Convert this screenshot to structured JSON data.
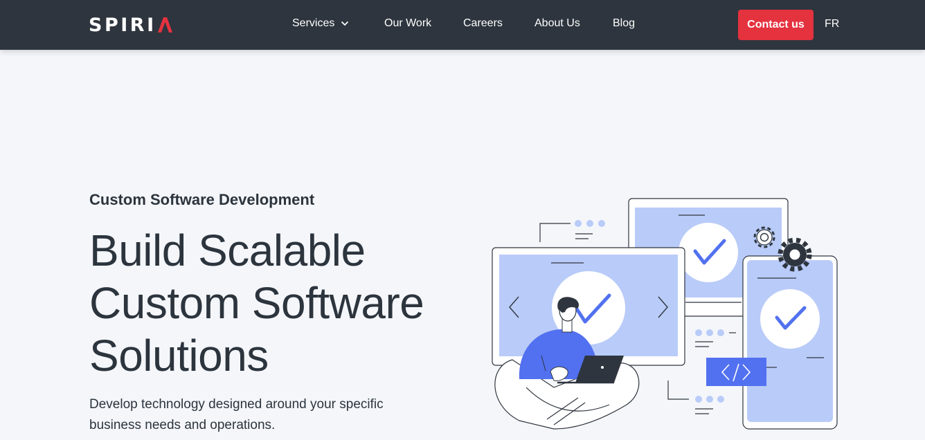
{
  "header": {
    "logo_text": "SPIRI",
    "nav": [
      {
        "label": "Services",
        "has_dropdown": true
      },
      {
        "label": "Our Work"
      },
      {
        "label": "Careers"
      },
      {
        "label": "About Us"
      },
      {
        "label": "Blog"
      }
    ],
    "contact_label": "Contact us",
    "language_label": "FR"
  },
  "hero": {
    "eyebrow": "Custom Software Development",
    "headline": [
      "Build Scalable",
      "Custom Software",
      "Solutions"
    ],
    "subtext": [
      "Develop technology designed around your specific",
      "business needs and operations."
    ]
  },
  "colors": {
    "nav_bg": "#2e353e",
    "accent_red": "#e4323f",
    "page_bg": "#f4f6fa",
    "illustration_blue": "#5271f0",
    "illustration_light_blue": "#b9cbf8"
  },
  "icons": {
    "logo_mark": "spiria-logo-mark",
    "dropdown": "chevron-down-icon",
    "gear": "gear-icon",
    "check": "checkmark-icon",
    "code": "code-brackets-icon",
    "arrow_left": "chevron-left-icon",
    "arrow_right": "chevron-right-icon"
  }
}
